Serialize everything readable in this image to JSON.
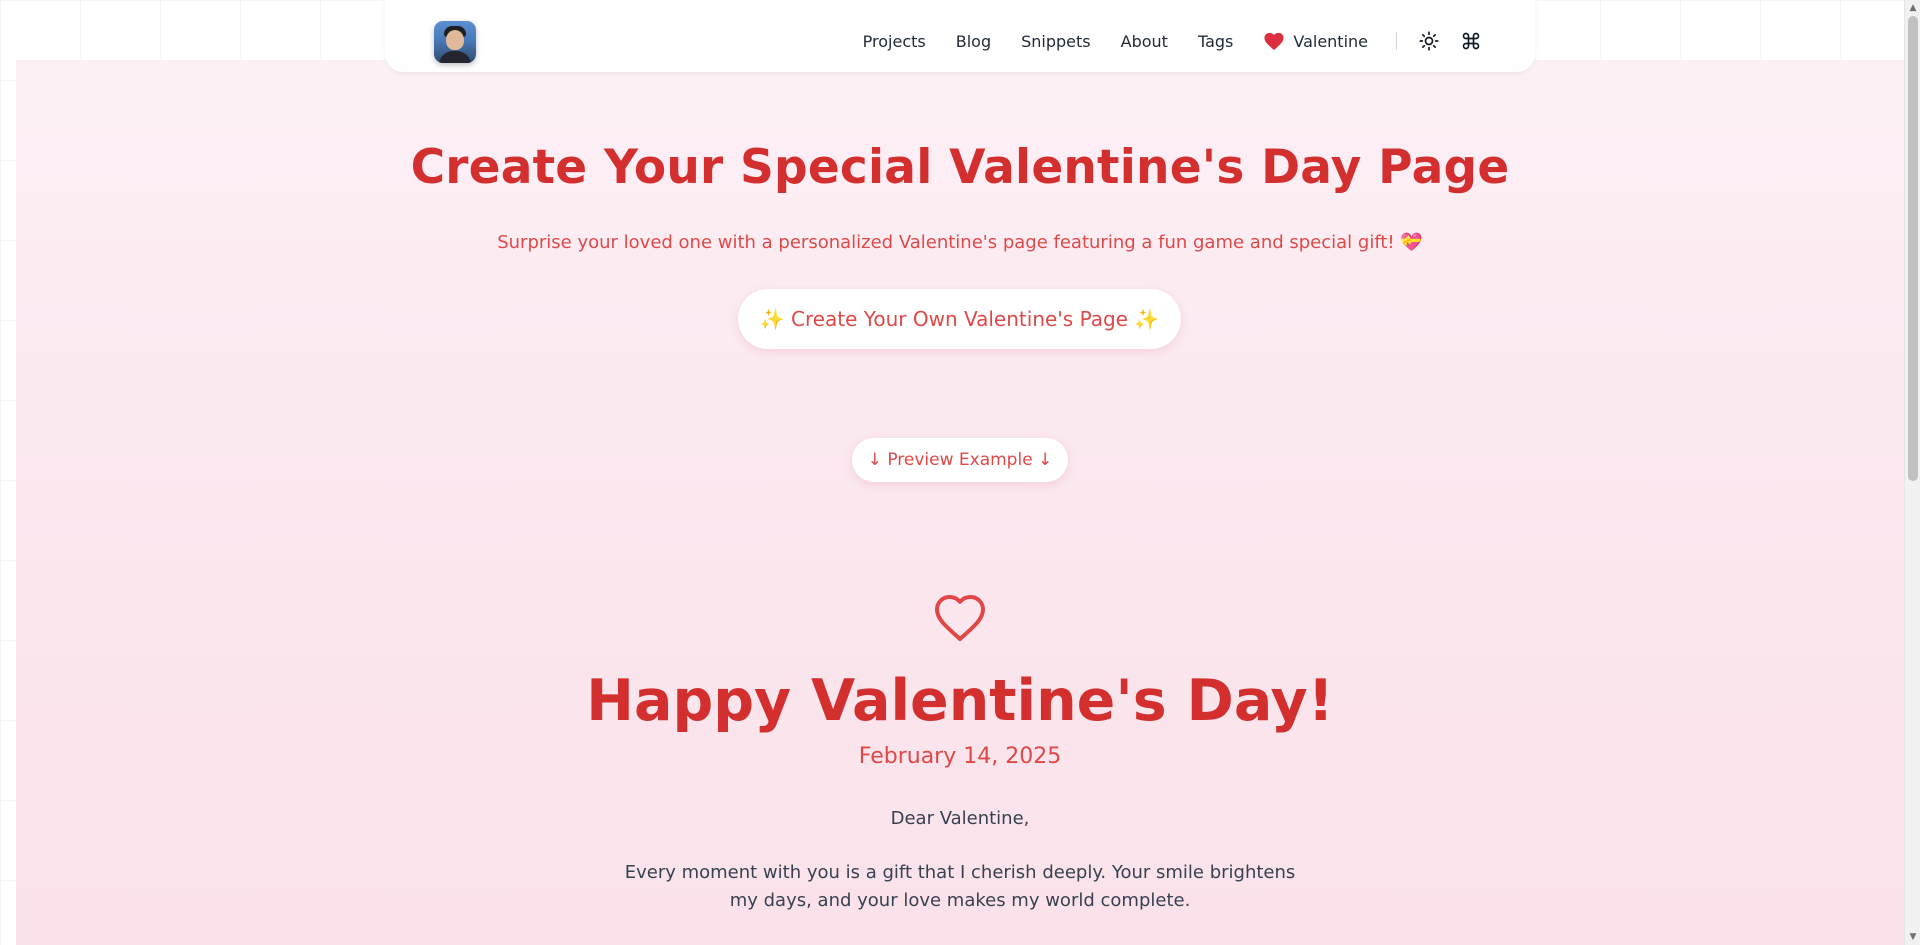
{
  "nav": {
    "items": [
      {
        "label": "Projects"
      },
      {
        "label": "Blog"
      },
      {
        "label": "Snippets"
      },
      {
        "label": "About"
      },
      {
        "label": "Tags"
      }
    ],
    "valentine_label": "Valentine",
    "icons": [
      "heart-icon",
      "sun-icon",
      "command-icon"
    ]
  },
  "hero": {
    "title": "Create Your Special Valentine's Day Page",
    "subtitle": "Surprise your loved one with a personalized Valentine's page featuring a fun game and special gift! 💝",
    "create_button": "✨ Create Your Own Valentine's Page ✨",
    "preview_button": "↓ Preview Example ↓"
  },
  "card": {
    "title": "Happy Valentine's Day!",
    "date": "February 14, 2025",
    "greeting": "Dear Valentine,",
    "message": "Every moment with you is a gift that I cherish deeply. Your smile brightens my days, and your love makes my world complete."
  },
  "colors": {
    "accent": "#d32f2f",
    "accent_light": "#e04848",
    "background_pink": "#fbe6ee"
  }
}
